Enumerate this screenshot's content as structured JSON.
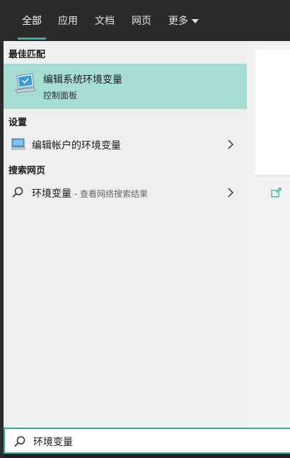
{
  "tabs": [
    {
      "label": "全部"
    },
    {
      "label": "应用"
    },
    {
      "label": "文档"
    },
    {
      "label": "网页"
    },
    {
      "label": "更多"
    }
  ],
  "sections": {
    "best_match": "最佳匹配",
    "settings": "设置",
    "web": "搜索网页"
  },
  "best_match": {
    "title": "编辑系统环境变量",
    "subtitle": "控制面板"
  },
  "settings_item": {
    "label": "编辑帐户的环境变量"
  },
  "web_item": {
    "query": "环境变量",
    "suffix": " - 查看网络搜索结果"
  },
  "search": {
    "value": "环境变量"
  },
  "colors": {
    "accent": "#2fb3a0",
    "highlight": "#a8ddd5",
    "tabbar": "#2b2b2b"
  }
}
